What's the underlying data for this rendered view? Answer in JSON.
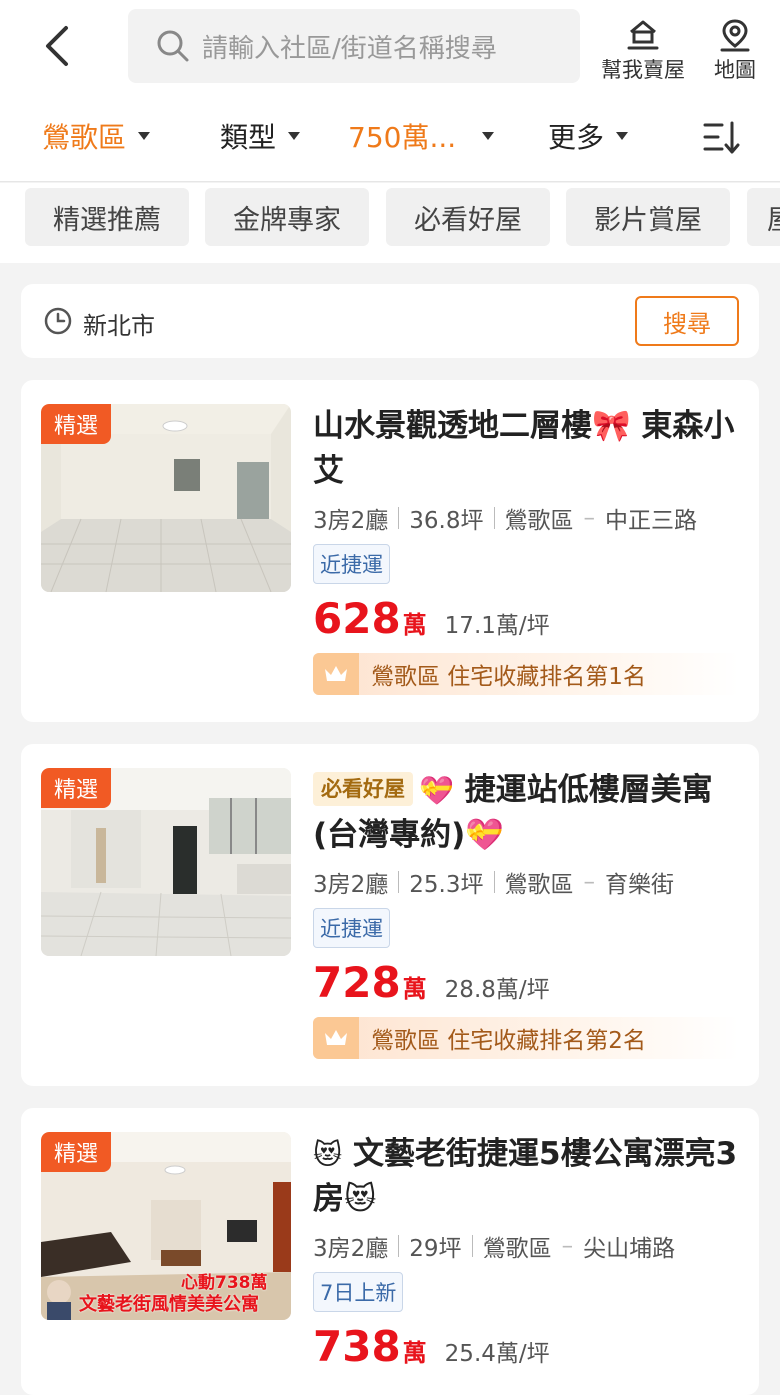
{
  "search": {
    "placeholder": "請輸入社區/街道名稱搜尋"
  },
  "top_actions": {
    "sell_label": "幫我賣屋",
    "map_label": "地圖"
  },
  "filters": {
    "district": "鶯歌區",
    "type": "類型",
    "price": "750萬...",
    "more": "更多"
  },
  "chips": [
    "精選推薦",
    "金牌專家",
    "必看好屋",
    "影片賞屋",
    "屋"
  ],
  "location": {
    "city": "新北市",
    "search_button": "搜尋"
  },
  "listings": [
    {
      "tag": "精選",
      "badge": "",
      "emoji_before": "",
      "title": "山水景觀透地二層樓🎀 東森小艾",
      "rooms": "3房2廳",
      "size": "36.8坪",
      "district": "鶯歌區",
      "road": "中正三路",
      "feature": "近捷運",
      "price": "628",
      "price_unit": "萬",
      "unit_price": "17.1萬/坪",
      "rank": "鶯歌區 住宅收藏排名第1名"
    },
    {
      "tag": "精選",
      "badge": "必看好屋",
      "emoji_before": "💝",
      "title": "捷運站低樓層美寓(台灣專約)💝",
      "rooms": "3房2廳",
      "size": "25.3坪",
      "district": "鶯歌區",
      "road": "育樂街",
      "feature": "近捷運",
      "price": "728",
      "price_unit": "萬",
      "unit_price": "28.8萬/坪",
      "rank": "鶯歌區 住宅收藏排名第2名"
    },
    {
      "tag": "精選",
      "badge": "",
      "emoji_before": "😻",
      "title": "文藝老街捷運5樓公寓漂亮3房😻",
      "rooms": "3房2廳",
      "size": "29坪",
      "district": "鶯歌區",
      "road": "尖山埔路",
      "feature": "7日上新",
      "price": "738",
      "price_unit": "萬",
      "unit_price": "25.4萬/坪",
      "thumb_overlay_top": "心動738萬",
      "thumb_overlay_bottom": "文藝老街風情美美公寓"
    }
  ],
  "colors": {
    "accent": "#ef7a1a",
    "price": "#e8141c",
    "featured_tag": "#f15a24"
  }
}
